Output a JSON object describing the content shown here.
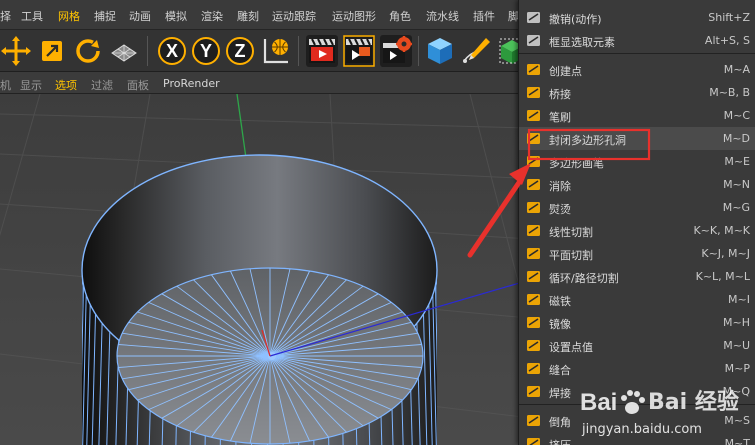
{
  "menubar": {
    "items": [
      "择",
      "工具",
      "网格",
      "捕捉",
      "动画",
      "模拟",
      "渲染",
      "雕刻",
      "运动跟踪",
      "运动图形",
      "角色",
      "流水线",
      "插件",
      "脚"
    ],
    "highlighted": "网格"
  },
  "toolbar": {
    "icons": [
      "move-icon",
      "scale-icon",
      "rotate-icon",
      "grid-icon",
      "x-axis-icon",
      "y-axis-icon",
      "z-axis-icon",
      "coordinate-system-icon",
      "render-view-icon",
      "render-picture-icon",
      "render-settings-icon",
      "cube-icon",
      "pen-icon",
      "subdivide-icon"
    ],
    "axis_labels": [
      "X",
      "Y",
      "Z"
    ]
  },
  "viewport_menu": {
    "items": [
      "机",
      "显示",
      "选项",
      "过滤",
      "面板",
      "ProRender"
    ],
    "active": "选项"
  },
  "context_menu": {
    "items": [
      {
        "label": "撤销(动作)",
        "shortcut": "Shift+Z",
        "icon": "undo-icon"
      },
      {
        "label": "框显选取元素",
        "shortcut": "Alt+S, S",
        "icon": "frame-selection-icon"
      },
      {
        "label": "创建点",
        "shortcut": "M~A",
        "icon": "create-point-icon"
      },
      {
        "label": "桥接",
        "shortcut": "M~B, B",
        "icon": "bridge-icon"
      },
      {
        "label": "笔刷",
        "shortcut": "M~C",
        "icon": "brush-icon"
      },
      {
        "label": "封闭多边形孔洞",
        "shortcut": "M~D",
        "icon": "close-polygon-hole-icon"
      },
      {
        "label": "多边形画笔",
        "shortcut": "M~E",
        "icon": "polygon-pen-icon"
      },
      {
        "label": "消除",
        "shortcut": "M~N",
        "icon": "dissolve-icon"
      },
      {
        "label": "熨烫",
        "shortcut": "M~G",
        "icon": "iron-icon"
      },
      {
        "label": "线性切割",
        "shortcut": "K~K, M~K",
        "icon": "line-cut-icon"
      },
      {
        "label": "平面切割",
        "shortcut": "K~J, M~J",
        "icon": "plane-cut-icon"
      },
      {
        "label": "循环/路径切割",
        "shortcut": "K~L, M~L",
        "icon": "loop-path-cut-icon"
      },
      {
        "label": "磁铁",
        "shortcut": "M~I",
        "icon": "magnet-icon"
      },
      {
        "label": "镜像",
        "shortcut": "M~H",
        "icon": "mirror-icon"
      },
      {
        "label": "设置点值",
        "shortcut": "M~U",
        "icon": "set-point-value-icon"
      },
      {
        "label": "缝合",
        "shortcut": "M~P",
        "icon": "stitch-icon"
      },
      {
        "label": "焊接",
        "shortcut": "M~Q",
        "icon": "weld-icon"
      },
      {
        "label": "倒角",
        "shortcut": "M~S",
        "icon": "bevel-icon"
      },
      {
        "label": "挤压",
        "shortcut": "M~T",
        "icon": "extrude-icon"
      }
    ],
    "highlighted_item": "封闭多边形孔洞"
  },
  "colors": {
    "accent": "#ffc400",
    "annotation_red": "#e8312c",
    "mesh_wire": "#7fb5ff",
    "axis_y": "#2ea64a",
    "axis_x": "#2a2ad6"
  },
  "watermark": {
    "brand": "Bai 经验",
    "url": "jingyan.baidu.com"
  }
}
